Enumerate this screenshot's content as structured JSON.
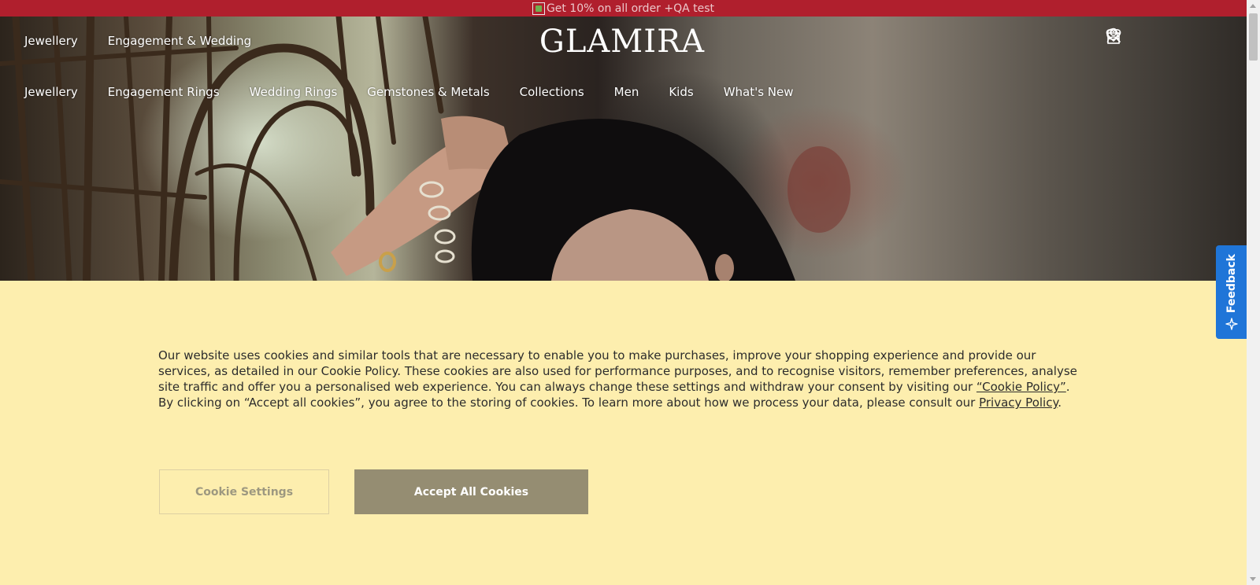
{
  "promo_bar": {
    "text": "Get 10% on all order +QA test",
    "background": "#b01f2d",
    "icon": "broken-image-icon"
  },
  "header": {
    "logo": "GLAMIRA",
    "top_nav": [
      "Jewellery",
      "Engagement & Wedding"
    ],
    "main_nav": [
      "Jewellery",
      "Engagement Rings",
      "Wedding Rings",
      "Gemstones & Metals",
      "Collections",
      "Men",
      "Kids",
      "What's New"
    ],
    "icons": [
      "search-icon",
      "account-icon",
      "wishlist-icon",
      "cart-icon"
    ]
  },
  "cookie_banner": {
    "background": "#fdeeae",
    "text_before_link1": "Our website uses cookies and similar tools that are necessary to enable you to make purchases, improve your shopping experience and provide our services, as detailed in our Cookie Policy. These cookies are also used for performance purposes, and to recognise visitors, remember preferences, analyse site traffic and offer you a personalised web experience. You can always change these settings and withdraw your consent by visiting our ",
    "link1": "“Cookie Policy”",
    "text_between": ". By clicking on “Accept all cookies”, you agree to the storing of cookies. To learn more about how we process your data, please consult our ",
    "link2": "Privacy Policy",
    "text_end": ".",
    "settings_button": "Cookie Settings",
    "accept_button": "Accept All Cookies",
    "accept_color": "#958d72"
  },
  "feedback": {
    "label": "Feedback",
    "color": "#1f75d8",
    "icon": "sparkle-icon"
  }
}
